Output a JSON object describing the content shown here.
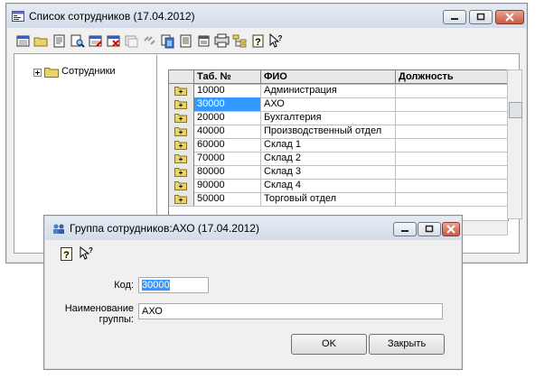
{
  "main_window": {
    "title": "Список сотрудников (17.04.2012)",
    "toolbar_icons": [
      "new-record-icon",
      "open-folder-icon",
      "save-icon",
      "find-icon",
      "edit-icon",
      "delete-icon",
      "copy-icon",
      "link-icon",
      "paste-icon",
      "duplicate-icon",
      "properties-icon",
      "print-icon",
      "tree-view-icon",
      "help-icon",
      "whats-this-icon"
    ],
    "tree": {
      "root_label": "Сотрудники"
    },
    "grid": {
      "columns": [
        "Таб. №",
        "ФИО",
        "Должность"
      ],
      "rows": [
        {
          "tab": "10000",
          "name": "Администрация",
          "position": ""
        },
        {
          "tab": "30000",
          "name": "АХО",
          "position": "",
          "selected": true
        },
        {
          "tab": "20000",
          "name": "Бухгалтерия",
          "position": ""
        },
        {
          "tab": "40000",
          "name": "Производственный отдел",
          "position": ""
        },
        {
          "tab": "60000",
          "name": "Склад 1",
          "position": ""
        },
        {
          "tab": "70000",
          "name": "Склад 2",
          "position": ""
        },
        {
          "tab": "80000",
          "name": "Склад 3",
          "position": ""
        },
        {
          "tab": "90000",
          "name": "Склад 4",
          "position": ""
        },
        {
          "tab": "50000",
          "name": "Торговый отдел",
          "position": ""
        }
      ]
    }
  },
  "dialog": {
    "title": "Группа сотрудников:АХО (17.04.2012)",
    "code_label": "Код:",
    "code_value": "30000",
    "name_label_1": "Наименование",
    "name_label_2": "группы:",
    "name_value": "АХО",
    "ok_label": "OK",
    "close_label": "Закрыть"
  },
  "colors": {
    "selection": "#3399ff",
    "close_button": "#c75a45",
    "folder": "#e8d46a"
  }
}
